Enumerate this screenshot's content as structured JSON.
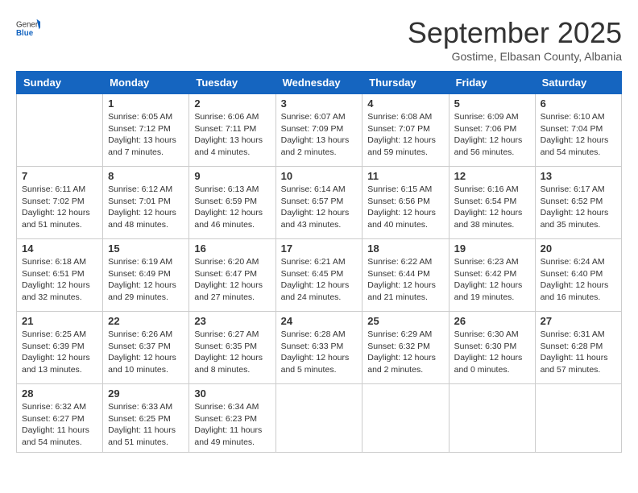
{
  "header": {
    "logo_general": "General",
    "logo_blue": "Blue",
    "month": "September 2025",
    "location": "Gostime, Elbasan County, Albania"
  },
  "weekdays": [
    "Sunday",
    "Monday",
    "Tuesday",
    "Wednesday",
    "Thursday",
    "Friday",
    "Saturday"
  ],
  "weeks": [
    [
      {
        "day": "",
        "sunrise": "",
        "sunset": "",
        "daylight": ""
      },
      {
        "day": "1",
        "sunrise": "Sunrise: 6:05 AM",
        "sunset": "Sunset: 7:12 PM",
        "daylight": "Daylight: 13 hours and 7 minutes."
      },
      {
        "day": "2",
        "sunrise": "Sunrise: 6:06 AM",
        "sunset": "Sunset: 7:11 PM",
        "daylight": "Daylight: 13 hours and 4 minutes."
      },
      {
        "day": "3",
        "sunrise": "Sunrise: 6:07 AM",
        "sunset": "Sunset: 7:09 PM",
        "daylight": "Daylight: 13 hours and 2 minutes."
      },
      {
        "day": "4",
        "sunrise": "Sunrise: 6:08 AM",
        "sunset": "Sunset: 7:07 PM",
        "daylight": "Daylight: 12 hours and 59 minutes."
      },
      {
        "day": "5",
        "sunrise": "Sunrise: 6:09 AM",
        "sunset": "Sunset: 7:06 PM",
        "daylight": "Daylight: 12 hours and 56 minutes."
      },
      {
        "day": "6",
        "sunrise": "Sunrise: 6:10 AM",
        "sunset": "Sunset: 7:04 PM",
        "daylight": "Daylight: 12 hours and 54 minutes."
      }
    ],
    [
      {
        "day": "7",
        "sunrise": "Sunrise: 6:11 AM",
        "sunset": "Sunset: 7:02 PM",
        "daylight": "Daylight: 12 hours and 51 minutes."
      },
      {
        "day": "8",
        "sunrise": "Sunrise: 6:12 AM",
        "sunset": "Sunset: 7:01 PM",
        "daylight": "Daylight: 12 hours and 48 minutes."
      },
      {
        "day": "9",
        "sunrise": "Sunrise: 6:13 AM",
        "sunset": "Sunset: 6:59 PM",
        "daylight": "Daylight: 12 hours and 46 minutes."
      },
      {
        "day": "10",
        "sunrise": "Sunrise: 6:14 AM",
        "sunset": "Sunset: 6:57 PM",
        "daylight": "Daylight: 12 hours and 43 minutes."
      },
      {
        "day": "11",
        "sunrise": "Sunrise: 6:15 AM",
        "sunset": "Sunset: 6:56 PM",
        "daylight": "Daylight: 12 hours and 40 minutes."
      },
      {
        "day": "12",
        "sunrise": "Sunrise: 6:16 AM",
        "sunset": "Sunset: 6:54 PM",
        "daylight": "Daylight: 12 hours and 38 minutes."
      },
      {
        "day": "13",
        "sunrise": "Sunrise: 6:17 AM",
        "sunset": "Sunset: 6:52 PM",
        "daylight": "Daylight: 12 hours and 35 minutes."
      }
    ],
    [
      {
        "day": "14",
        "sunrise": "Sunrise: 6:18 AM",
        "sunset": "Sunset: 6:51 PM",
        "daylight": "Daylight: 12 hours and 32 minutes."
      },
      {
        "day": "15",
        "sunrise": "Sunrise: 6:19 AM",
        "sunset": "Sunset: 6:49 PM",
        "daylight": "Daylight: 12 hours and 29 minutes."
      },
      {
        "day": "16",
        "sunrise": "Sunrise: 6:20 AM",
        "sunset": "Sunset: 6:47 PM",
        "daylight": "Daylight: 12 hours and 27 minutes."
      },
      {
        "day": "17",
        "sunrise": "Sunrise: 6:21 AM",
        "sunset": "Sunset: 6:45 PM",
        "daylight": "Daylight: 12 hours and 24 minutes."
      },
      {
        "day": "18",
        "sunrise": "Sunrise: 6:22 AM",
        "sunset": "Sunset: 6:44 PM",
        "daylight": "Daylight: 12 hours and 21 minutes."
      },
      {
        "day": "19",
        "sunrise": "Sunrise: 6:23 AM",
        "sunset": "Sunset: 6:42 PM",
        "daylight": "Daylight: 12 hours and 19 minutes."
      },
      {
        "day": "20",
        "sunrise": "Sunrise: 6:24 AM",
        "sunset": "Sunset: 6:40 PM",
        "daylight": "Daylight: 12 hours and 16 minutes."
      }
    ],
    [
      {
        "day": "21",
        "sunrise": "Sunrise: 6:25 AM",
        "sunset": "Sunset: 6:39 PM",
        "daylight": "Daylight: 12 hours and 13 minutes."
      },
      {
        "day": "22",
        "sunrise": "Sunrise: 6:26 AM",
        "sunset": "Sunset: 6:37 PM",
        "daylight": "Daylight: 12 hours and 10 minutes."
      },
      {
        "day": "23",
        "sunrise": "Sunrise: 6:27 AM",
        "sunset": "Sunset: 6:35 PM",
        "daylight": "Daylight: 12 hours and 8 minutes."
      },
      {
        "day": "24",
        "sunrise": "Sunrise: 6:28 AM",
        "sunset": "Sunset: 6:33 PM",
        "daylight": "Daylight: 12 hours and 5 minutes."
      },
      {
        "day": "25",
        "sunrise": "Sunrise: 6:29 AM",
        "sunset": "Sunset: 6:32 PM",
        "daylight": "Daylight: 12 hours and 2 minutes."
      },
      {
        "day": "26",
        "sunrise": "Sunrise: 6:30 AM",
        "sunset": "Sunset: 6:30 PM",
        "daylight": "Daylight: 12 hours and 0 minutes."
      },
      {
        "day": "27",
        "sunrise": "Sunrise: 6:31 AM",
        "sunset": "Sunset: 6:28 PM",
        "daylight": "Daylight: 11 hours and 57 minutes."
      }
    ],
    [
      {
        "day": "28",
        "sunrise": "Sunrise: 6:32 AM",
        "sunset": "Sunset: 6:27 PM",
        "daylight": "Daylight: 11 hours and 54 minutes."
      },
      {
        "day": "29",
        "sunrise": "Sunrise: 6:33 AM",
        "sunset": "Sunset: 6:25 PM",
        "daylight": "Daylight: 11 hours and 51 minutes."
      },
      {
        "day": "30",
        "sunrise": "Sunrise: 6:34 AM",
        "sunset": "Sunset: 6:23 PM",
        "daylight": "Daylight: 11 hours and 49 minutes."
      },
      {
        "day": "",
        "sunrise": "",
        "sunset": "",
        "daylight": ""
      },
      {
        "day": "",
        "sunrise": "",
        "sunset": "",
        "daylight": ""
      },
      {
        "day": "",
        "sunrise": "",
        "sunset": "",
        "daylight": ""
      },
      {
        "day": "",
        "sunrise": "",
        "sunset": "",
        "daylight": ""
      }
    ]
  ]
}
